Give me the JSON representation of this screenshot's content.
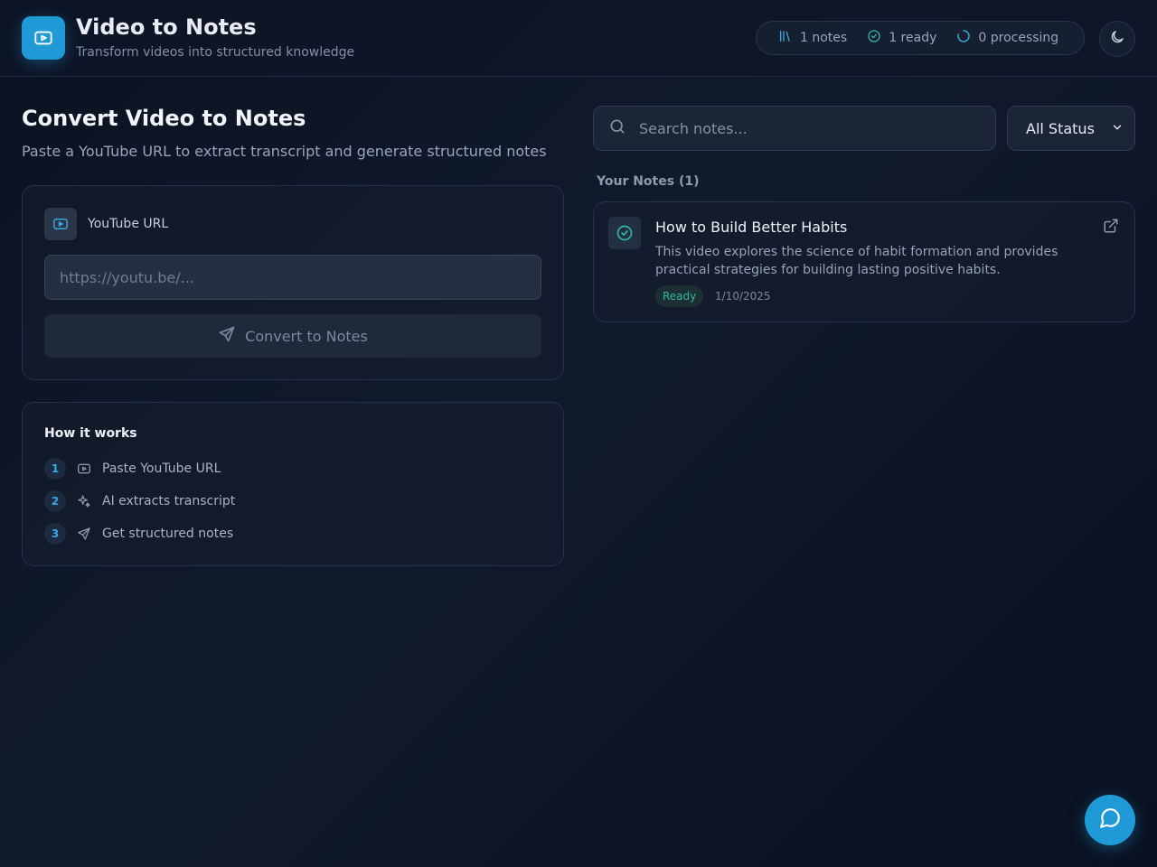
{
  "header": {
    "title": "Video to Notes",
    "subtitle": "Transform videos into structured knowledge",
    "stats": {
      "notes": "1 notes",
      "ready": "1 ready",
      "processing": "0 processing"
    }
  },
  "converter": {
    "title": "Convert Video to Notes",
    "description": "Paste a YouTube URL to extract transcript and generate structured notes",
    "url_label": "YouTube URL",
    "url_placeholder": "https://youtu.be/...",
    "url_value": "",
    "button_label": "Convert to Notes"
  },
  "how_it_works": {
    "title": "How it works",
    "steps": [
      {
        "number": "1",
        "label": "Paste YouTube URL",
        "icon": "youtube-icon"
      },
      {
        "number": "2",
        "label": "AI extracts transcript",
        "icon": "sparkles-icon"
      },
      {
        "number": "3",
        "label": "Get structured notes",
        "icon": "send-icon"
      }
    ]
  },
  "notes_panel": {
    "search_placeholder": "Search notes...",
    "search_value": "",
    "status_filter": "All Status",
    "heading": "Your Notes (1)",
    "notes": [
      {
        "title": "How to Build Better Habits",
        "description": "This video explores the science of habit formation and provides practical strategies for building lasting positive habits.",
        "status": "Ready",
        "date": "1/10/2025"
      }
    ]
  },
  "colors": {
    "accent": "#1f9ad6",
    "ready": "#2fb89a",
    "background": "#0b1222"
  }
}
